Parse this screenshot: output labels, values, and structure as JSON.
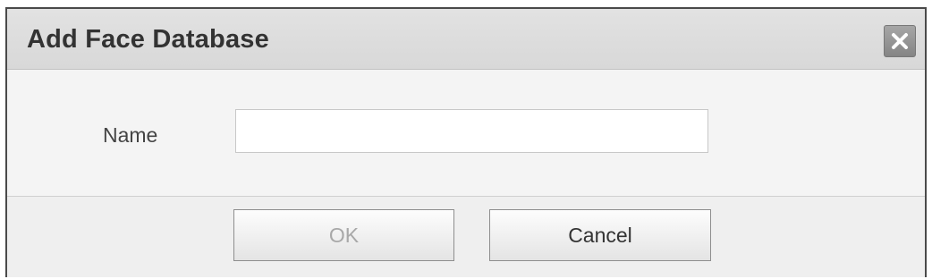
{
  "dialog": {
    "title": "Add Face Database",
    "close_icon": "close-icon"
  },
  "form": {
    "name_label": "Name",
    "name_value": "",
    "name_placeholder": ""
  },
  "footer": {
    "ok_label": "OK",
    "cancel_label": "Cancel",
    "ok_disabled": true
  },
  "colors": {
    "titlebar": "#dcdcdc",
    "body": "#f4f4f4",
    "close_button": "#959595",
    "disabled_text": "#a8a8a8"
  }
}
